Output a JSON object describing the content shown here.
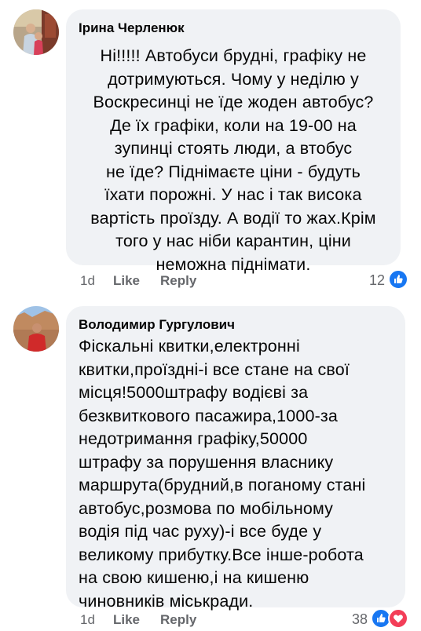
{
  "comments": [
    {
      "author": "Ірина Черленюк",
      "text": "Ні!!!!! Автобуси брудні, графіку не\nдотримуються. Чому у неділю у\nВоскресинці не їде жоден автобус?\nДе їх графіки, коли на 19-00 на\nзупинці стоять люди, а втобус\n не їде? Піднімаєте ціни - будуть\nїхати порожні. У нас і так висока\nвартість проїзду. А водії то жах.Крім\nтого у нас ніби карантин, ціни\nнеможна піднімати.",
      "time": "1d",
      "like_label": "Like",
      "reply_label": "Reply",
      "reaction_count": "12",
      "reactions": [
        "like-icon"
      ]
    },
    {
      "author": "Володимир Гургулович",
      "text": "Фіскальні квитки,електронні\nквитки,проїздні-і все стане на свої\nмісця!5000штрафу водієві за\nбезквиткового пасажира,1000-за\nнедотримання графіку,50000\nштрафу за порушення власнику\nмаршрута(брудний,в поганому стані\nавтобус,розмова по мобільному\nводія під час руху)-і все буде у\nвеликому прибутку.Все інше-робота\nна свою кишеню,і на кишеню\nчиновників міськради.",
      "time": "1d",
      "like_label": "Like",
      "reply_label": "Reply",
      "reaction_count": "38",
      "reactions": [
        "like-icon",
        "love-icon"
      ]
    }
  ],
  "colors": {
    "bubble": "#f0f2f5",
    "meta_text": "#65676b",
    "like_blue": "#1877f2",
    "love_red": "#f33e58"
  }
}
